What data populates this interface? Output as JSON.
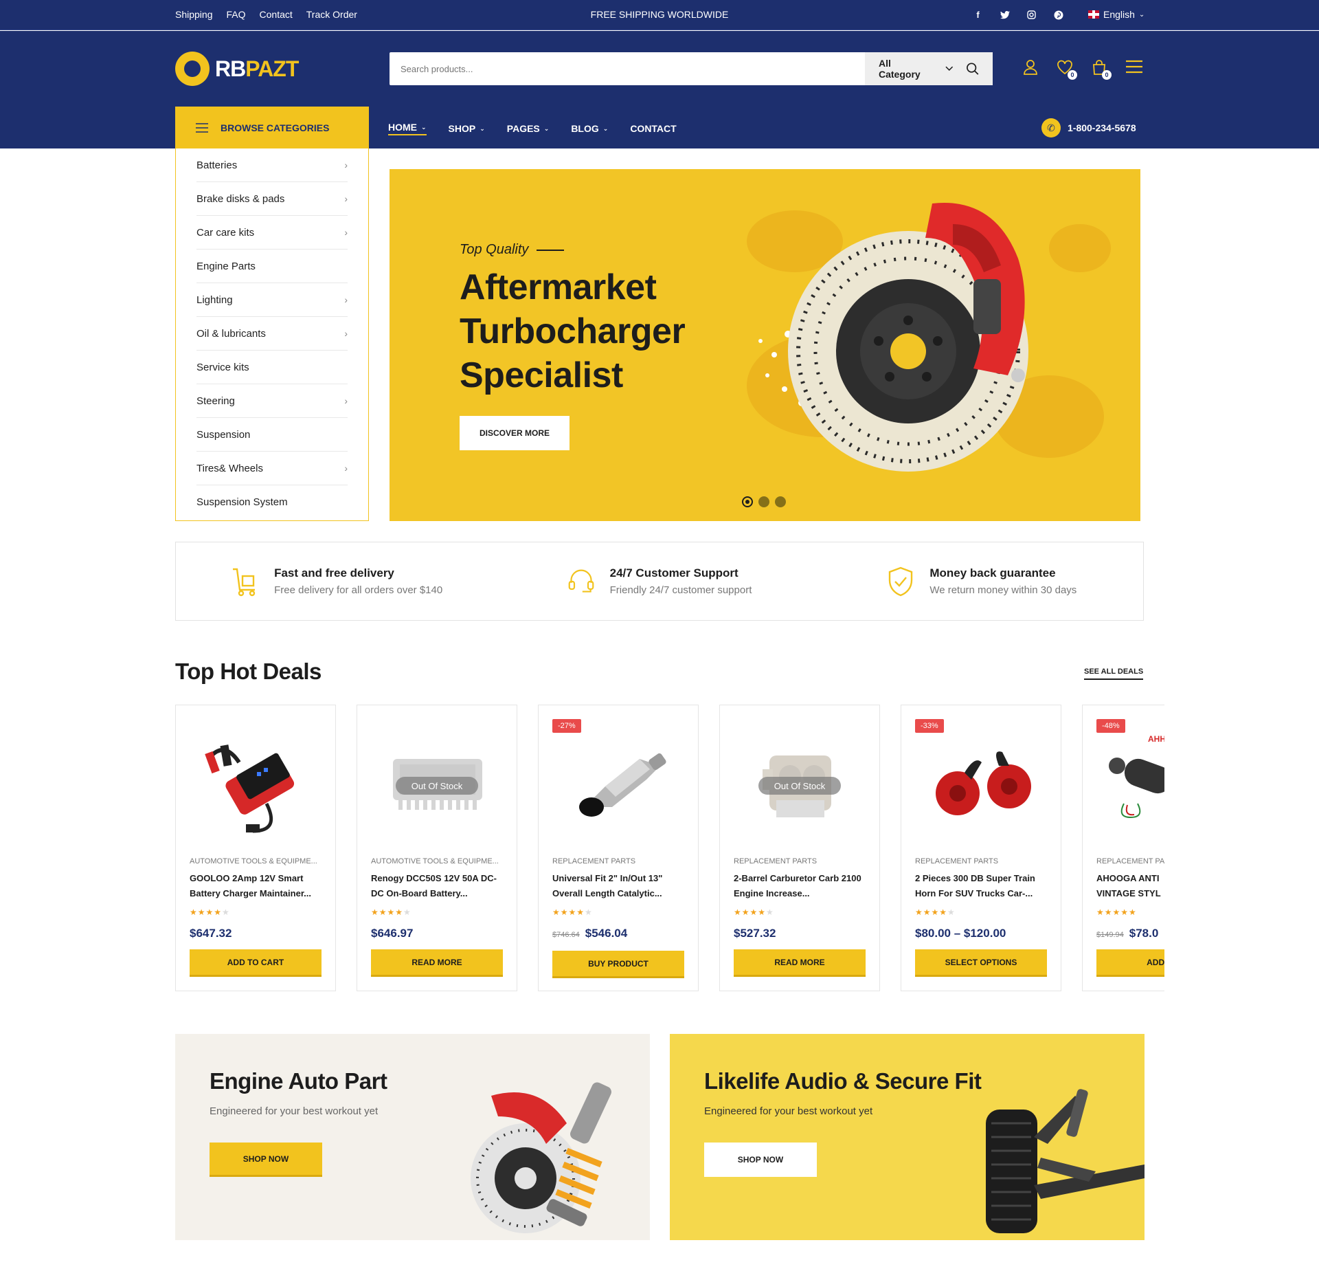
{
  "topbar": {
    "links": [
      "Shipping",
      "FAQ",
      "Contact",
      "Track Order"
    ],
    "promo": "FREE SHIPPING WORLDWIDE",
    "social": [
      "facebook-icon",
      "twitter-icon",
      "instagram-icon",
      "pinterest-icon"
    ],
    "language": "English"
  },
  "header": {
    "logo_rb": "RB",
    "logo_pazt": "PAZT",
    "search_placeholder": "Search products...",
    "category_select": "All Category",
    "wishlist_count": "0",
    "cart_count": "0"
  },
  "nav": {
    "browse_label": "BROWSE CATEGORIES",
    "links": [
      "HOME",
      "SHOP",
      "PAGES",
      "BLOG",
      "CONTACT"
    ],
    "phone": "1-800-234-5678"
  },
  "categories": [
    {
      "label": "Batteries",
      "has_sub": true
    },
    {
      "label": "Brake disks & pads",
      "has_sub": true
    },
    {
      "label": "Car care kits",
      "has_sub": true
    },
    {
      "label": "Engine Parts",
      "has_sub": false
    },
    {
      "label": "Lighting",
      "has_sub": true
    },
    {
      "label": "Oil & lubricants",
      "has_sub": true
    },
    {
      "label": "Service kits",
      "has_sub": false
    },
    {
      "label": "Steering",
      "has_sub": true
    },
    {
      "label": "Suspension",
      "has_sub": false
    },
    {
      "label": "Tires& Wheels",
      "has_sub": true
    },
    {
      "label": "Suspension System",
      "has_sub": false
    }
  ],
  "hero": {
    "eyebrow": "Top Quality",
    "title": "Aftermarket Turbocharger Specialist",
    "button": "DISCOVER MORE",
    "slides": 3,
    "active_slide": 1
  },
  "features": [
    {
      "icon": "delivery-cart-icon",
      "title": "Fast and free delivery",
      "text": "Free delivery for all orders over $140"
    },
    {
      "icon": "headset-icon",
      "title": "24/7 Customer Support",
      "text": "Friendly 24/7 customer support"
    },
    {
      "icon": "shield-check-icon",
      "title": "Money back guarantee",
      "text": "We return money within 30 days"
    }
  ],
  "deals": {
    "title": "Top Hot Deals",
    "see_all": "SEE ALL DEALS",
    "products": [
      {
        "category": "AUTOMOTIVE TOOLS & EQUIPME...",
        "name": "GOOLOO 2Amp 12V Smart Battery Charger Maintainer...",
        "rating": 3.5,
        "old_price": "",
        "price": "$647.32",
        "button": "ADD TO CART",
        "badge": "",
        "out_of_stock": false,
        "image": "battery-charger"
      },
      {
        "category": "AUTOMOTIVE TOOLS & EQUIPME...",
        "name": "Renogy DCC50S 12V 50A DC-DC On-Board Battery...",
        "rating": 4,
        "old_price": "",
        "price": "$646.97",
        "button": "READ MORE",
        "badge": "",
        "out_of_stock": true,
        "out_of_stock_label": "Out Of Stock",
        "image": "charger-box"
      },
      {
        "category": "REPLACEMENT PARTS",
        "name": "Universal Fit 2\" In/Out 13\" Overall Length Catalytic...",
        "rating": 4,
        "old_price": "$746.64",
        "price": "$546.04",
        "button": "BUY PRODUCT",
        "badge": "-27%",
        "out_of_stock": false,
        "image": "catalytic-converter"
      },
      {
        "category": "REPLACEMENT PARTS",
        "name": "2-Barrel Carburetor Carb 2100 Engine Increase...",
        "rating": 4,
        "old_price": "",
        "price": "$527.32",
        "button": "READ MORE",
        "badge": "",
        "out_of_stock": true,
        "out_of_stock_label": "Out Of Stock",
        "image": "carburetor"
      },
      {
        "category": "REPLACEMENT PARTS",
        "name": "2 Pieces 300 DB Super Train Horn For SUV Trucks Car-...",
        "rating": 4,
        "old_price": "",
        "price": "$80.00 – $120.00",
        "button": "SELECT OPTIONS",
        "badge": "-33%",
        "out_of_stock": false,
        "image": "horns"
      },
      {
        "category": "REPLACEMENT PA",
        "name": "AHOOGA ANTI VINTAGE STYL",
        "rating": 4.5,
        "old_price": "$149.94",
        "price": "$78.0",
        "button": "ADD TO",
        "badge": "-48%",
        "out_of_stock": false,
        "image": "vintage-horn",
        "image_label": "AHH"
      }
    ]
  },
  "banners": [
    {
      "title": "Engine Auto Part",
      "subtitle": "Engineered for your best workout yet",
      "button": "SHOP NOW"
    },
    {
      "title": "Likelife Audio & Secure Fit",
      "subtitle": "Engineered for your best workout yet",
      "button": "SHOP NOW"
    }
  ],
  "colors": {
    "navy": "#1d2f6e",
    "yellow": "#f2c31e",
    "hero_bg": "#f2c526",
    "sale_red": "#e94b4b",
    "price_blue": "#1d2f6e"
  }
}
